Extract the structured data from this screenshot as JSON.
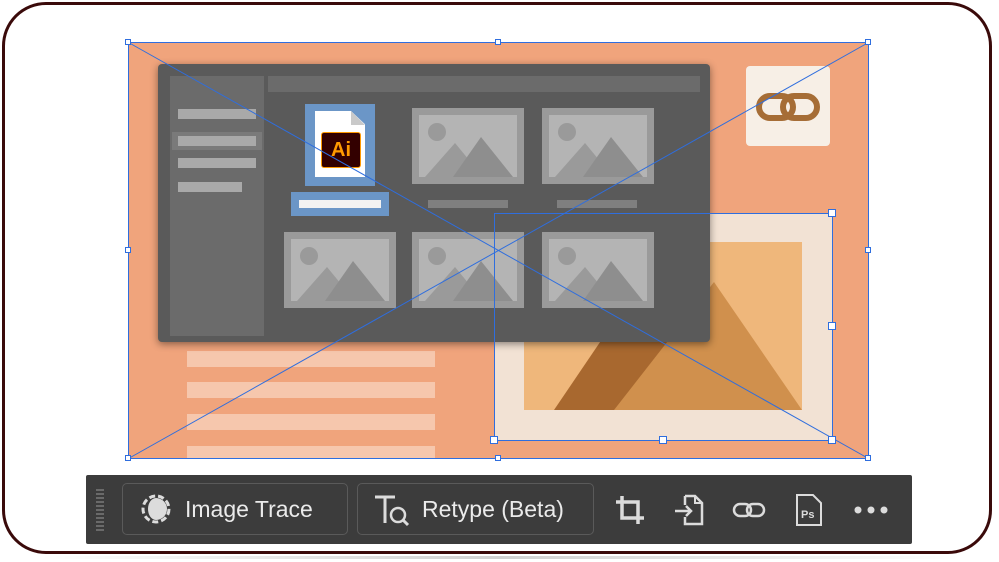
{
  "colors": {
    "frame_border": "#3a0a0a",
    "artboard": "#f0a47c",
    "dialog": "#5a5a5a",
    "selection": "#2f6ede",
    "toolbar": "#3c3c3c",
    "toolbar_text": "#ebebeb",
    "ai_orange": "#ff9a00",
    "link_brown": "#a66d36"
  },
  "canvas": {
    "file_badge_text": "Ai",
    "link_icon": "link-icon"
  },
  "toolbar": {
    "buttons": [
      {
        "label": "Image Trace",
        "icon": "image-trace-icon"
      },
      {
        "label": "Retype (Beta)",
        "icon": "retype-icon"
      }
    ],
    "icons": [
      {
        "name": "crop-icon"
      },
      {
        "name": "embed-icon"
      },
      {
        "name": "link-icon"
      },
      {
        "name": "photoshop-icon",
        "text": "Ps"
      },
      {
        "name": "more-options-icon"
      }
    ]
  }
}
